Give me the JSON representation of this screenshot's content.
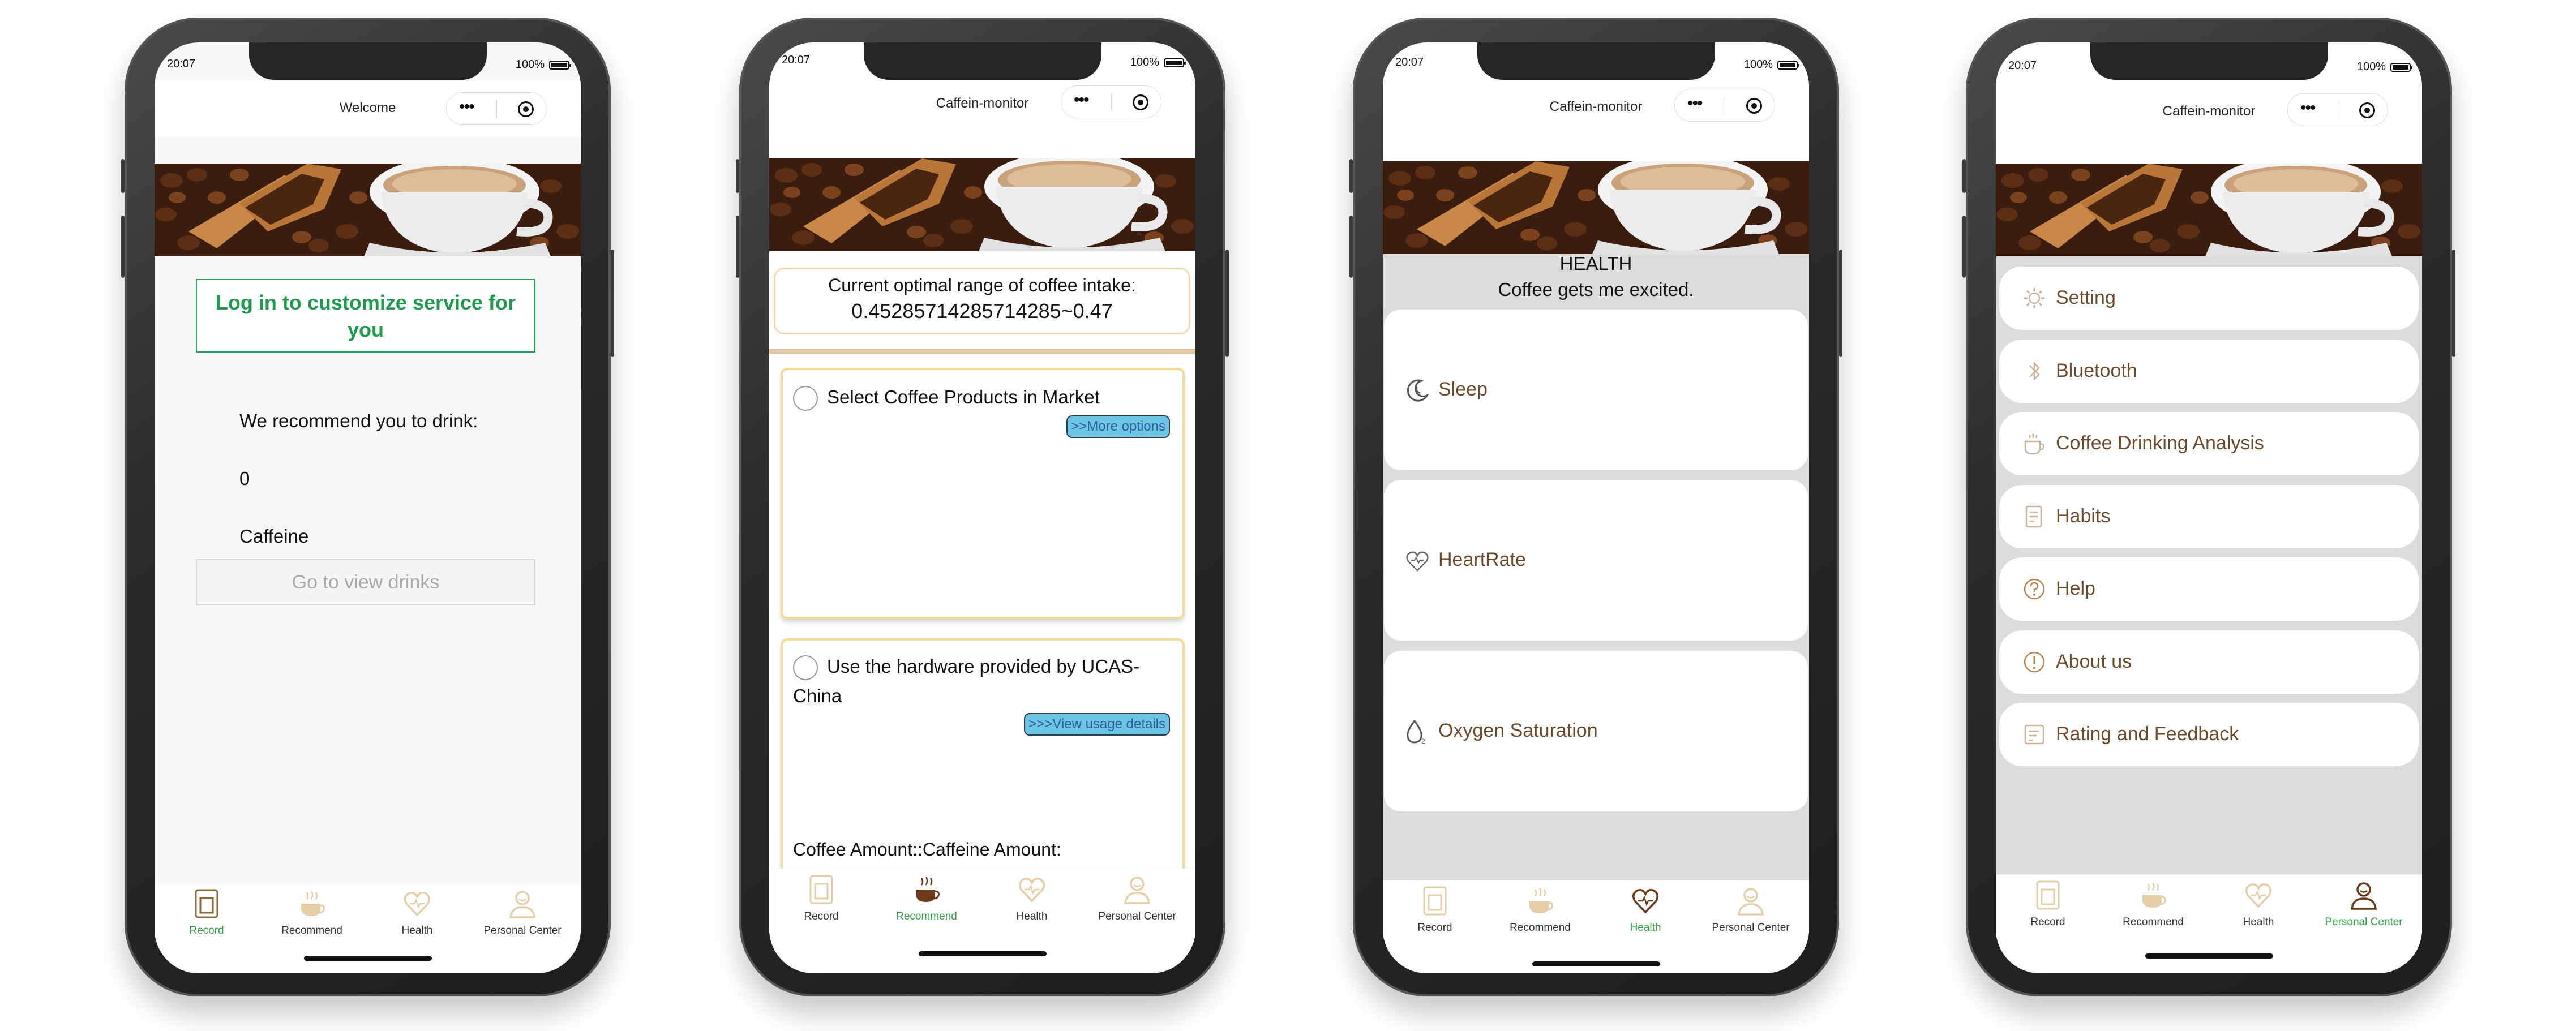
{
  "status": {
    "time": "20:07",
    "battery": "100%"
  },
  "phones": [
    {
      "nav_title": "Welcome",
      "login_label": "Log in to customize service for you",
      "recommend_label": "We recommend you to drink:",
      "amount": "0",
      "unit": "Caffeine",
      "view_label": "Go to view drinks"
    },
    {
      "nav_title": "Caffein-monitor",
      "range_label": "Current optimal range of coffee intake:",
      "range_value": "0.45285714285714285~0.47",
      "option1_label": "Select Coffee Products in Market",
      "option1_link": ">>More options",
      "option2_label_line1": "Use the hardware provided by UCAS-",
      "option2_label_line2": "China",
      "option2_link": ">>>View usage details",
      "amount_line": "Coffee Amount::Caffeine Amount:"
    },
    {
      "nav_title": "Caffein-monitor",
      "title": "HEALTH",
      "subtitle": "Coffee gets me excited.",
      "cards": [
        {
          "label": "Sleep",
          "icon": "moon-icon"
        },
        {
          "label": "HeartRate",
          "icon": "heart-pulse-icon"
        },
        {
          "label": "Oxygen Saturation",
          "icon": "droplet-o2-icon"
        }
      ]
    },
    {
      "nav_title": "Caffein-monitor",
      "menu": [
        {
          "label": "Setting",
          "icon": "gear-icon"
        },
        {
          "label": "Bluetooth",
          "icon": "bluetooth-icon"
        },
        {
          "label": "Coffee Drinking Analysis",
          "icon": "cup-icon"
        },
        {
          "label": "Habits",
          "icon": "document-icon"
        },
        {
          "label": "Help",
          "icon": "help-icon"
        },
        {
          "label": "About us",
          "icon": "info-icon"
        },
        {
          "label": "Rating and Feedback",
          "icon": "feedback-icon"
        }
      ]
    }
  ],
  "tabs": [
    {
      "label": "Record",
      "icon": "record-icon"
    },
    {
      "label": "Recommend",
      "icon": "coffee-icon"
    },
    {
      "label": "Health",
      "icon": "heart-icon"
    },
    {
      "label": "Personal Center",
      "icon": "person-icon"
    }
  ],
  "colors": {
    "accent_green": "#2ea043",
    "text_brown": "#6b4a2c",
    "link_blue_bg": "#6cc6e3",
    "card_gold_border": "#f1dc9c"
  }
}
